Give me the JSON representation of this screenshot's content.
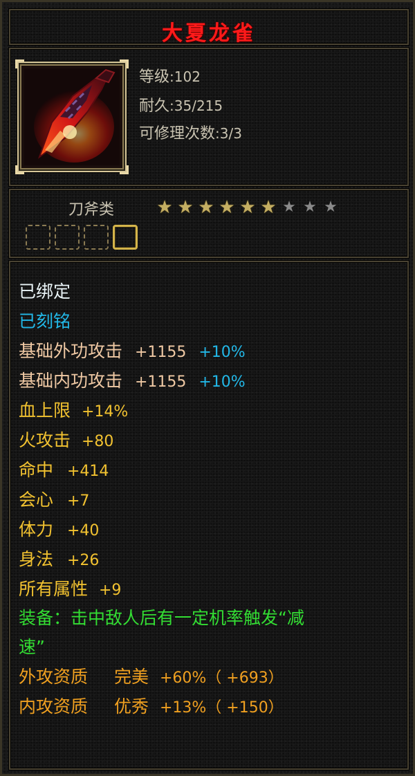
{
  "item": {
    "name": "大夏龙雀",
    "name_color": "#ff1a1a",
    "icon": "dragon-blade-icon"
  },
  "stats": {
    "level_label": "等级",
    "level_value": ":102",
    "durability_label": "耐久",
    "durability_value": ":35/215",
    "repair_label": "可修理次数",
    "repair_value": ":3/3"
  },
  "category": {
    "label": "刀斧类",
    "stars_filled": 6,
    "stars_total": 9
  },
  "sockets": {
    "total": 4,
    "active_index": 3
  },
  "properties": {
    "bound": "已绑定",
    "engraved": "已刻铭",
    "base_ext_attack_label": "基础外功攻击",
    "base_ext_attack_value": "+1155",
    "base_ext_attack_bonus": "+10%",
    "base_int_attack_label": "基础内功攻击",
    "base_int_attack_value": "+1155",
    "base_int_attack_bonus": "+10%",
    "hp_cap_label": "血上限",
    "hp_cap_value": "+14%",
    "fire_attack_label": "火攻击",
    "fire_attack_value": "+80",
    "hit_label": "命中",
    "hit_value": "+414",
    "crit_label": "会心",
    "crit_value": "+7",
    "stamina_label": "体力",
    "stamina_value": "+40",
    "agility_label": "身法",
    "agility_value": "+26",
    "all_attr_label": "所有属性",
    "all_attr_value": "+9",
    "equip_effect_line1": "装备：击中敌人后有一定机率触发“减",
    "equip_effect_line2": "速”",
    "ext_aptitude_label": "外攻资质",
    "ext_aptitude_grade": "完美",
    "ext_aptitude_value": "+60%（ +693）",
    "int_aptitude_label": "内攻资质",
    "int_aptitude_grade": "优秀",
    "int_aptitude_value": "+13%（ +150）"
  },
  "colors": {
    "white": "#e9f3f6",
    "cyan": "#22b8e8",
    "peach": "#f0c9a4",
    "gold": "#f2c230",
    "green": "#33dd33",
    "orange": "#f0a020"
  }
}
